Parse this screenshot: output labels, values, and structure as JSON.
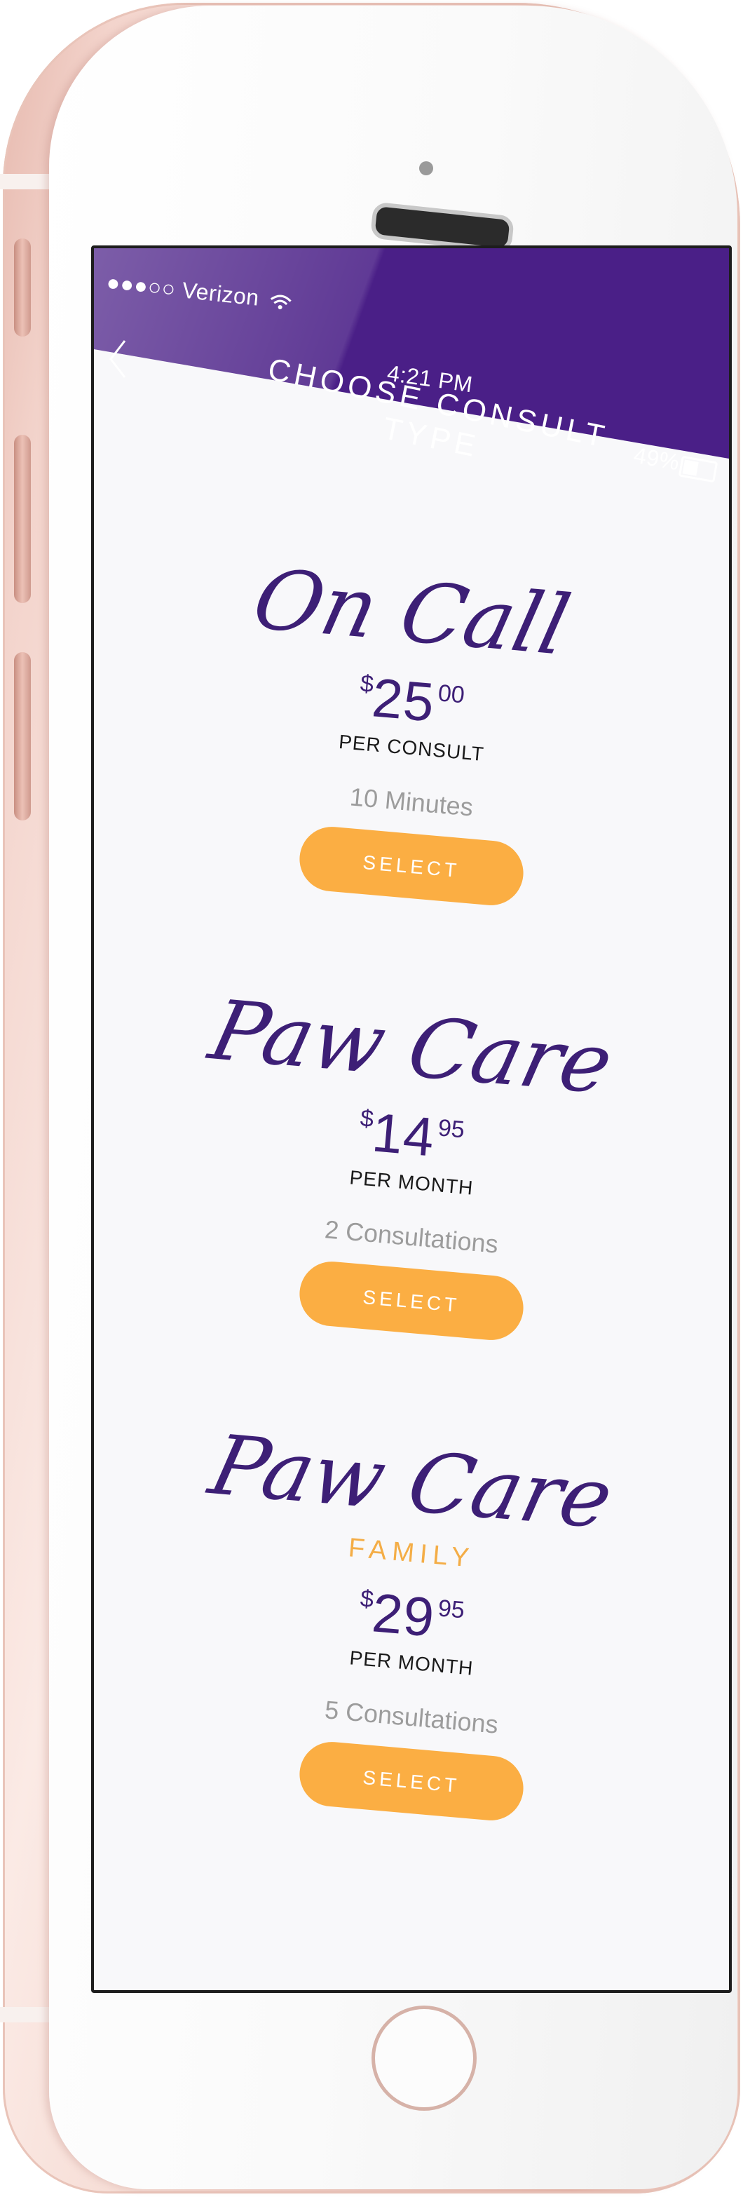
{
  "status_bar": {
    "carrier": "●●●○○ Verizon",
    "time": "4:21 PM",
    "battery": "49%"
  },
  "nav": {
    "title": "CHOOSE CONSULT TYPE",
    "back_icon": "chevron-left-icon"
  },
  "colors": {
    "nav_bg": "#4a1f87",
    "plan_title": "#3d1f76",
    "select_button": "#fbae43",
    "subtitle_accent": "#f4ad46"
  },
  "plans": [
    {
      "name": "On Call",
      "subtitle": "",
      "currency": "$",
      "price_dollars": "25",
      "price_cents": "00",
      "period": "PER CONSULT",
      "detail": "10 Minutes",
      "button_label": "SELECT"
    },
    {
      "name": "Paw Care",
      "subtitle": "",
      "currency": "$",
      "price_dollars": "14",
      "price_cents": "95",
      "period": "PER MONTH",
      "detail": "2 Consultations",
      "button_label": "SELECT"
    },
    {
      "name": "Paw Care",
      "subtitle": "FAMILY",
      "currency": "$",
      "price_dollars": "29",
      "price_cents": "95",
      "period": "PER MONTH",
      "detail": "5 Consultations",
      "button_label": "SELECT"
    }
  ]
}
